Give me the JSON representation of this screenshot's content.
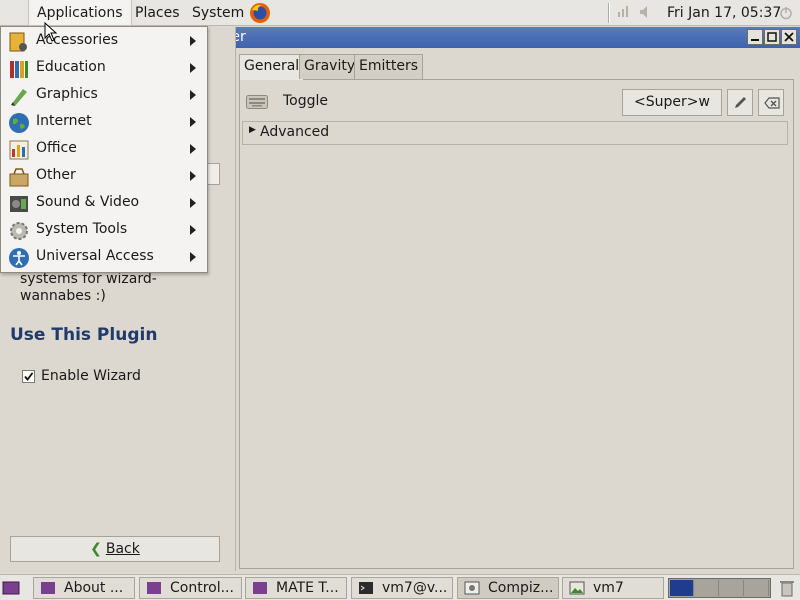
{
  "top_panel": {
    "applications": "Applications",
    "places": "Places",
    "system": "System",
    "clock": "Fri Jan 17, 05:37"
  },
  "window": {
    "title_fragment": "nager"
  },
  "apps_menu": {
    "items": [
      {
        "label": "Accessories",
        "icon": "accessories-icon"
      },
      {
        "label": "Education",
        "icon": "education-icon"
      },
      {
        "label": "Graphics",
        "icon": "graphics-icon"
      },
      {
        "label": "Internet",
        "icon": "internet-icon"
      },
      {
        "label": "Office",
        "icon": "office-icon"
      },
      {
        "label": "Other",
        "icon": "other-icon"
      },
      {
        "label": "Sound & Video",
        "icon": "sound-video-icon"
      },
      {
        "label": "System Tools",
        "icon": "system-tools-icon"
      },
      {
        "label": "Universal Access",
        "icon": "universal-access-icon"
      }
    ]
  },
  "left_pane": {
    "description": "systems for wizard-wannabes :)",
    "use_plugin_heading": "Use This Plugin",
    "enable_label": "Enable Wizard",
    "enable_checked": true,
    "back_label": "Back"
  },
  "tabs": [
    "General",
    "Gravity",
    "Emitters"
  ],
  "general": {
    "toggle_label": "Toggle",
    "shortcut": "<Super>w",
    "advanced_label": "Advanced"
  },
  "taskbar": {
    "tasks": [
      "About ...",
      "Control...",
      "MATE T...",
      "vm7@v...",
      "Compiz...",
      "vm7"
    ],
    "active_task_index": 4,
    "active_workspace_index": 0
  },
  "colors": {
    "titlebar": "#3e62ad",
    "heading": "#1f3a6b",
    "workspace_active": "#1f3d8f"
  }
}
